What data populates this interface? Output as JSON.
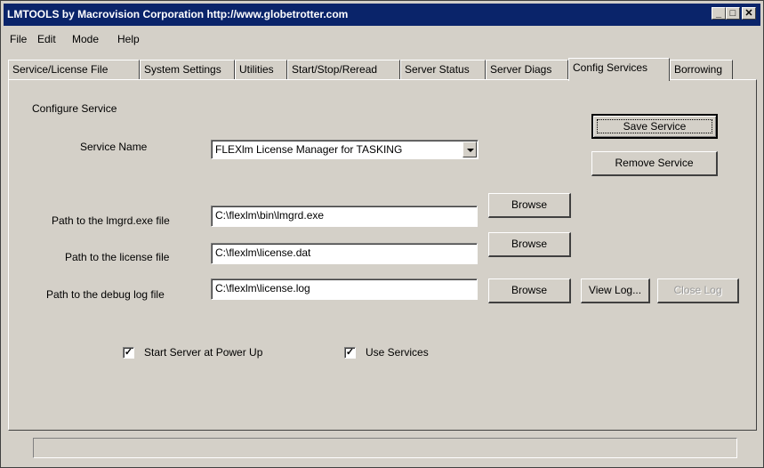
{
  "window": {
    "title": "LMTOOLS by Macrovision Corporation http://www.globetrotter.com",
    "controls": {
      "minimize": "_",
      "maximize": "□",
      "close": "✕"
    }
  },
  "menu": [
    "File",
    "Edit",
    "Mode",
    "Help"
  ],
  "tabs": [
    "Service/License File",
    "System Settings",
    "Utilities",
    "Start/Stop/Reread",
    "Server Status",
    "Server Diags",
    "Config Services",
    "Borrowing"
  ],
  "active_tab": "Config Services",
  "config": {
    "heading": "Configure Service",
    "service_name_label": "Service Name",
    "service_name_value": "FLEXlm License Manager for TASKING",
    "save_button": "Save Service",
    "remove_button": "Remove Service",
    "lmgrd_label": "Path to the lmgrd.exe file",
    "lmgrd_value": "C:\\flexlm\\bin\\lmgrd.exe",
    "license_label": "Path to the license file",
    "license_value": "C:\\flexlm\\license.dat",
    "debuglog_label": "Path to the debug log file",
    "debuglog_value": "C:\\flexlm\\license.log",
    "browse_label": "Browse",
    "view_log_button": "View Log...",
    "close_log_button": "Close Log",
    "start_at_powerup_label": "Start Server at Power Up",
    "start_at_powerup_checked": true,
    "use_services_label": "Use Services",
    "use_services_checked": true,
    "check_mark": "✓"
  },
  "status": {
    "text": ""
  }
}
